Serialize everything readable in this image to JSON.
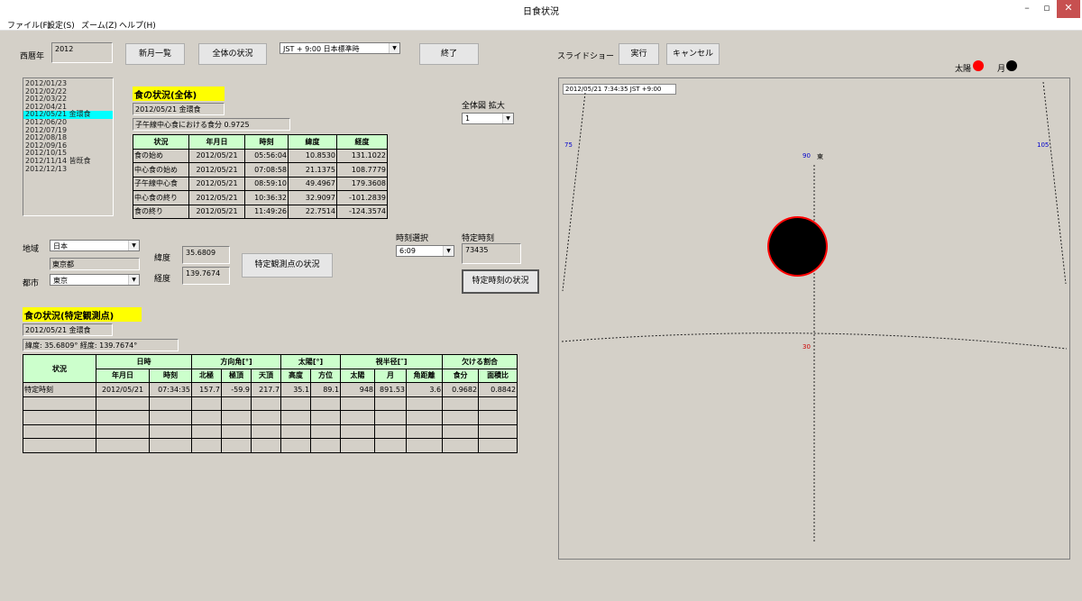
{
  "window": {
    "title": "日食状況",
    "min": "–",
    "max": "▫",
    "close": "✕"
  },
  "menu": [
    "ファイル(F)",
    "設定(S)",
    "ズーム(Z)",
    "ヘルプ(H)"
  ],
  "toolbar": {
    "year_label": "西暦年",
    "year_value": "2012",
    "newmoon_button": "新月一覧",
    "overall_button": "全体の状況",
    "timezone_value": "JST  + 9:00 日本標準時",
    "exit_button": "終了",
    "slideshow_label": "スライドショー",
    "run_button": "実行",
    "cancel_button": "キャンセル"
  },
  "legend": {
    "sun_label": "太陽",
    "moon_label": "月",
    "sun_color": "#ff0000",
    "moon_color": "#000000"
  },
  "dates": [
    {
      "text": "2012/01/23",
      "selected": false
    },
    {
      "text": "2012/02/22",
      "selected": false
    },
    {
      "text": "2012/03/22",
      "selected": false
    },
    {
      "text": "2012/04/21",
      "selected": false
    },
    {
      "text": "2012/05/21 金環食",
      "selected": true
    },
    {
      "text": "2012/06/20",
      "selected": false
    },
    {
      "text": "2012/07/19",
      "selected": false
    },
    {
      "text": "2012/08/18",
      "selected": false
    },
    {
      "text": "2012/09/16",
      "selected": false
    },
    {
      "text": "2012/10/15",
      "selected": false
    },
    {
      "text": "2012/11/14 皆既食",
      "selected": false
    },
    {
      "text": "2012/12/13",
      "selected": false
    }
  ],
  "overall": {
    "heading": "食の状況(全体)",
    "date_type": "2012/05/21 金環食",
    "noon_magnitude": "子午線中心食における食分 0.9725",
    "headers": [
      "状況",
      "年月日",
      "時刻",
      "緯度",
      "経度"
    ],
    "rows": [
      [
        "食の始め",
        "2012/05/21",
        "05:56:04",
        "10.8530",
        "131.1022"
      ],
      [
        "中心食の始め",
        "2012/05/21",
        "07:08:58",
        "21.1375",
        "108.7779"
      ],
      [
        "子午線中心食",
        "2012/05/21",
        "08:59:10",
        "49.4967",
        "179.3608"
      ],
      [
        "中心食の終り",
        "2012/05/21",
        "10:36:32",
        "32.9097",
        "-101.2839"
      ],
      [
        "食の終り",
        "2012/05/21",
        "11:49:26",
        "22.7514",
        "-124.3574"
      ]
    ]
  },
  "zoom": {
    "label": "全体図 拡大",
    "value": "1"
  },
  "location": {
    "region_label": "地域",
    "region_value": "日本",
    "prefecture_value": "東京都",
    "city_label": "都市",
    "city_value": "東京",
    "lat_label": "緯度",
    "lat_value": "35.6809",
    "lon_label": "経度",
    "lon_value": "139.7674",
    "observe_button": "特定観測点の状況"
  },
  "time": {
    "select_label": "時刻選択",
    "select_value": "6:09",
    "specific_label": "特定時刻",
    "specific_value": "73435",
    "specific_button": "特定時刻の状況"
  },
  "local": {
    "heading": "食の状況(特定観測点)",
    "date_type": "2012/05/21  金環食",
    "coords": "緯度: 35.6809°  経度: 139.7674°",
    "group_headers": [
      "状況",
      "日時",
      "方向角[°]",
      "太陽[°]",
      "視半径[″]",
      "欠ける割合"
    ],
    "sub_headers": [
      "年月日",
      "時刻",
      "北極",
      "極頂",
      "天頂",
      "高度",
      "方位",
      "太陽",
      "月",
      "角距離",
      "食分",
      "面積比"
    ],
    "row": [
      "特定時刻",
      "2012/05/21",
      "07:34:35",
      "157.7",
      "-59.9",
      "217.7",
      "35.1",
      "89.1",
      "948",
      "891.53",
      "3.6",
      "0.9682",
      "0.8842"
    ]
  },
  "sky": {
    "timestamp": "2012/05/21  7:34:35  JST +9:00",
    "az_left": "75",
    "az_center": "90",
    "az_right": "105",
    "direction": "東",
    "alt_label": "30"
  }
}
